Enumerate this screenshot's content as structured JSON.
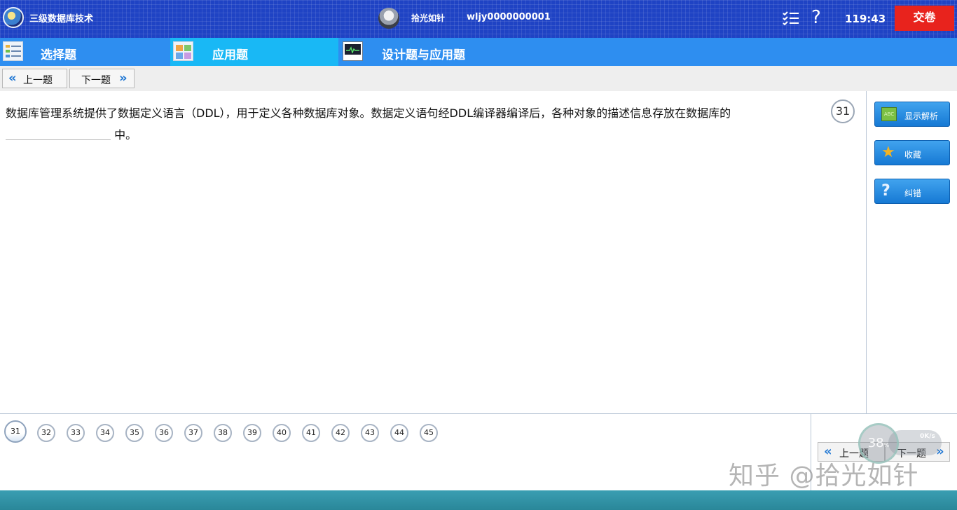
{
  "header": {
    "app_title": "三级数据库技术",
    "user_name": "拾光如针",
    "user_id": "wljy0000000001",
    "timer": "119:43",
    "submit_label": "交卷",
    "help_glyph": "?",
    "icons": [
      "app-logo",
      "user-avatar",
      "question-list-icon",
      "help-icon"
    ]
  },
  "tabs": [
    {
      "label": "选择题",
      "icon": "list-icon",
      "active": false
    },
    {
      "label": "应用题",
      "icon": "grid-icon",
      "active": true
    },
    {
      "label": "设计题与应用题",
      "icon": "monitor-icon",
      "active": false
    }
  ],
  "nav": {
    "prev_label": "上一题",
    "next_label": "下一题",
    "prev_chevron": "«",
    "next_chevron": "»"
  },
  "question": {
    "text_before": "数据库管理系统提供了数据定义语言（DDL），用于定义各种数据库对象。数据定义语句经DDL编译器编译后，各种对象的描述信息存放在数据库的",
    "text_after": "中。",
    "number": "31"
  },
  "side": {
    "show_analysis": "显示解析",
    "favorite": "收藏",
    "report_error": "纠错",
    "abc_icon_text": "ABC",
    "star_glyph": "★",
    "question_glyph": "?"
  },
  "question_numbers": [
    "31",
    "32",
    "33",
    "34",
    "35",
    "36",
    "37",
    "38",
    "39",
    "40",
    "41",
    "42",
    "43",
    "44",
    "45"
  ],
  "current_question": "31",
  "overlay": {
    "speed_percent": "38",
    "speed_unit": "%",
    "speed_rate": "0K/s",
    "watermark": "知乎 @拾光如针"
  },
  "colors": {
    "header_bg": "#1f43c4",
    "tabbar_bg": "#2e8ef0",
    "active_tab": "#19b8f5",
    "submit_bg": "#e8231d",
    "footer_bg": "#2a8799"
  }
}
